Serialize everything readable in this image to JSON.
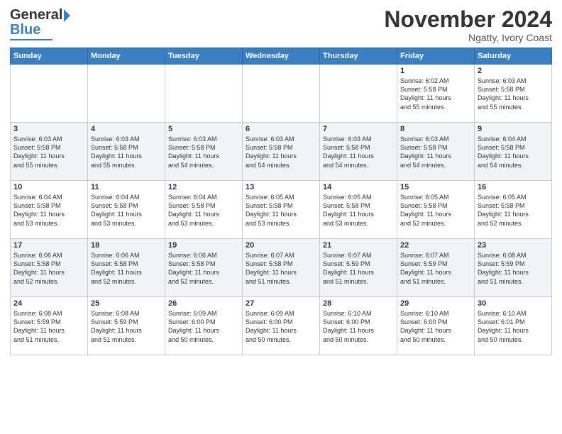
{
  "logo": {
    "line1": "General",
    "line2": "Blue"
  },
  "header": {
    "month": "November 2024",
    "location": "Ngatty, Ivory Coast"
  },
  "weekdays": [
    "Sunday",
    "Monday",
    "Tuesday",
    "Wednesday",
    "Thursday",
    "Friday",
    "Saturday"
  ],
  "weeks": [
    [
      {
        "day": "",
        "content": ""
      },
      {
        "day": "",
        "content": ""
      },
      {
        "day": "",
        "content": ""
      },
      {
        "day": "",
        "content": ""
      },
      {
        "day": "",
        "content": ""
      },
      {
        "day": "1",
        "content": "Sunrise: 6:02 AM\nSunset: 5:58 PM\nDaylight: 11 hours\nand 55 minutes."
      },
      {
        "day": "2",
        "content": "Sunrise: 6:03 AM\nSunset: 5:58 PM\nDaylight: 11 hours\nand 55 minutes."
      }
    ],
    [
      {
        "day": "3",
        "content": "Sunrise: 6:03 AM\nSunset: 5:58 PM\nDaylight: 11 hours\nand 55 minutes."
      },
      {
        "day": "4",
        "content": "Sunrise: 6:03 AM\nSunset: 5:58 PM\nDaylight: 11 hours\nand 55 minutes."
      },
      {
        "day": "5",
        "content": "Sunrise: 6:03 AM\nSunset: 5:58 PM\nDaylight: 11 hours\nand 54 minutes."
      },
      {
        "day": "6",
        "content": "Sunrise: 6:03 AM\nSunset: 5:58 PM\nDaylight: 11 hours\nand 54 minutes."
      },
      {
        "day": "7",
        "content": "Sunrise: 6:03 AM\nSunset: 5:58 PM\nDaylight: 11 hours\nand 54 minutes."
      },
      {
        "day": "8",
        "content": "Sunrise: 6:03 AM\nSunset: 5:58 PM\nDaylight: 11 hours\nand 54 minutes."
      },
      {
        "day": "9",
        "content": "Sunrise: 6:04 AM\nSunset: 5:58 PM\nDaylight: 11 hours\nand 54 minutes."
      }
    ],
    [
      {
        "day": "10",
        "content": "Sunrise: 6:04 AM\nSunset: 5:58 PM\nDaylight: 11 hours\nand 53 minutes."
      },
      {
        "day": "11",
        "content": "Sunrise: 6:04 AM\nSunset: 5:58 PM\nDaylight: 11 hours\nand 53 minutes."
      },
      {
        "day": "12",
        "content": "Sunrise: 6:04 AM\nSunset: 5:58 PM\nDaylight: 11 hours\nand 53 minutes."
      },
      {
        "day": "13",
        "content": "Sunrise: 6:05 AM\nSunset: 5:58 PM\nDaylight: 11 hours\nand 53 minutes."
      },
      {
        "day": "14",
        "content": "Sunrise: 6:05 AM\nSunset: 5:58 PM\nDaylight: 11 hours\nand 53 minutes."
      },
      {
        "day": "15",
        "content": "Sunrise: 6:05 AM\nSunset: 5:58 PM\nDaylight: 11 hours\nand 52 minutes."
      },
      {
        "day": "16",
        "content": "Sunrise: 6:05 AM\nSunset: 5:58 PM\nDaylight: 11 hours\nand 52 minutes."
      }
    ],
    [
      {
        "day": "17",
        "content": "Sunrise: 6:06 AM\nSunset: 5:58 PM\nDaylight: 11 hours\nand 52 minutes."
      },
      {
        "day": "18",
        "content": "Sunrise: 6:06 AM\nSunset: 5:58 PM\nDaylight: 11 hours\nand 52 minutes."
      },
      {
        "day": "19",
        "content": "Sunrise: 6:06 AM\nSunset: 5:58 PM\nDaylight: 11 hours\nand 52 minutes."
      },
      {
        "day": "20",
        "content": "Sunrise: 6:07 AM\nSunset: 5:58 PM\nDaylight: 11 hours\nand 51 minutes."
      },
      {
        "day": "21",
        "content": "Sunrise: 6:07 AM\nSunset: 5:59 PM\nDaylight: 11 hours\nand 51 minutes."
      },
      {
        "day": "22",
        "content": "Sunrise: 6:07 AM\nSunset: 5:59 PM\nDaylight: 11 hours\nand 51 minutes."
      },
      {
        "day": "23",
        "content": "Sunrise: 6:08 AM\nSunset: 5:59 PM\nDaylight: 11 hours\nand 51 minutes."
      }
    ],
    [
      {
        "day": "24",
        "content": "Sunrise: 6:08 AM\nSunset: 5:59 PM\nDaylight: 11 hours\nand 51 minutes."
      },
      {
        "day": "25",
        "content": "Sunrise: 6:08 AM\nSunset: 5:59 PM\nDaylight: 11 hours\nand 51 minutes."
      },
      {
        "day": "26",
        "content": "Sunrise: 6:09 AM\nSunset: 6:00 PM\nDaylight: 11 hours\nand 50 minutes."
      },
      {
        "day": "27",
        "content": "Sunrise: 6:09 AM\nSunset: 6:00 PM\nDaylight: 11 hours\nand 50 minutes."
      },
      {
        "day": "28",
        "content": "Sunrise: 6:10 AM\nSunset: 6:00 PM\nDaylight: 11 hours\nand 50 minutes."
      },
      {
        "day": "29",
        "content": "Sunrise: 6:10 AM\nSunset: 6:00 PM\nDaylight: 11 hours\nand 50 minutes."
      },
      {
        "day": "30",
        "content": "Sunrise: 6:10 AM\nSunset: 6:01 PM\nDaylight: 11 hours\nand 50 minutes."
      }
    ]
  ]
}
